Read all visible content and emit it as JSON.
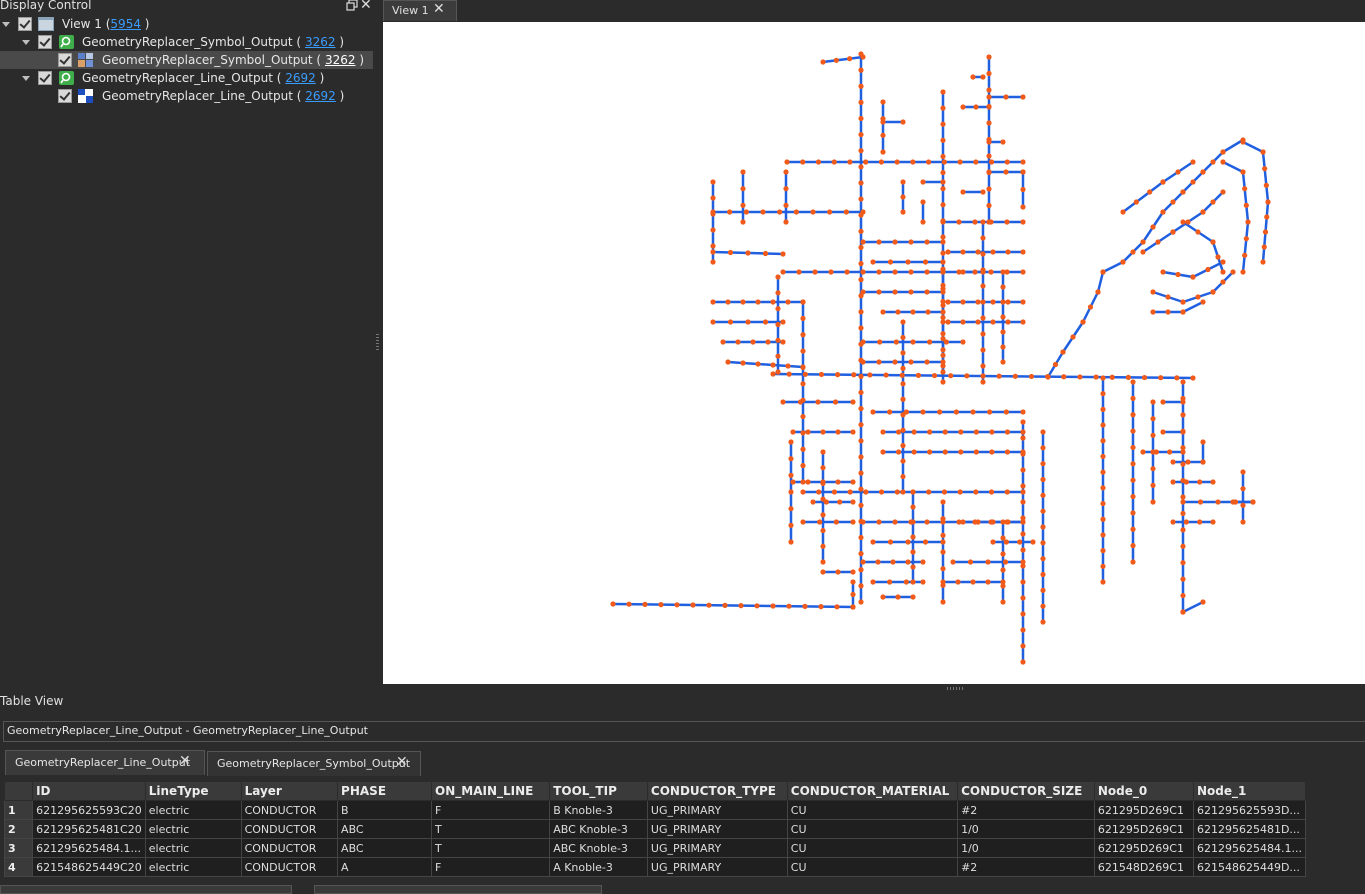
{
  "display_control": {
    "title": "Display Control",
    "view": {
      "label": "View 1 (",
      "count": "5954",
      "close": ")"
    },
    "layers": [
      {
        "label": "GeometryReplacer_Symbol_Output (",
        "count": "3262",
        "close": ")"
      },
      {
        "label": "GeometryReplacer_Symbol_Output (",
        "count": "3262",
        "close": ")"
      },
      {
        "label": "GeometryReplacer_Line_Output (",
        "count": "2692",
        "close": ")"
      },
      {
        "label": "GeometryReplacer_Line_Output (",
        "count": "2692",
        "close": ")"
      }
    ]
  },
  "view_tab": {
    "label": "View 1"
  },
  "map": {
    "line_color": "#1f5fe0",
    "node_color": "#f05a1a",
    "background": "#ffffff"
  },
  "table_view": {
    "title": "Table View",
    "path": "GeometryReplacer_Line_Output - GeometryReplacer_Line_Output",
    "tabs": [
      "GeometryReplacer_Line_Output",
      "GeometryReplacer_Symbol_Output"
    ],
    "columns": [
      "ID",
      "LineType",
      "Layer",
      "PHASE",
      "ON_MAIN_LINE",
      "TOOL_TIP",
      "CONDUCTOR_TYPE",
      "CONDUCTOR_MATERIAL",
      "CONDUCTOR_SIZE",
      "Node_0",
      "Node_1"
    ],
    "rows": [
      {
        "n": "1",
        "cells": [
          "621295625593C20",
          "electric",
          "CONDUCTOR",
          "B",
          "F",
          "B Knoble-3",
          "UG_PRIMARY",
          "CU",
          "#2",
          "621295D269C1",
          "621295625593D..."
        ]
      },
      {
        "n": "2",
        "cells": [
          "621295625481C20",
          "electric",
          "CONDUCTOR",
          "ABC",
          "T",
          "ABC Knoble-3",
          "UG_PRIMARY",
          "CU",
          "1/0",
          "621295D269C1",
          "621295625481D..."
        ]
      },
      {
        "n": "3",
        "cells": [
          "621295625484.1...",
          "electric",
          "CONDUCTOR",
          "ABC",
          "T",
          "ABC Knoble-3",
          "UG_PRIMARY",
          "CU",
          "1/0",
          "621295D269C1",
          "621295625484.1..."
        ]
      },
      {
        "n": "4",
        "cells": [
          "621548625449C20",
          "electric",
          "CONDUCTOR",
          "A",
          "F",
          "A Knoble-3",
          "UG_PRIMARY",
          "CU",
          "#2",
          "621548D269C1",
          "621548625449D..."
        ]
      }
    ]
  }
}
